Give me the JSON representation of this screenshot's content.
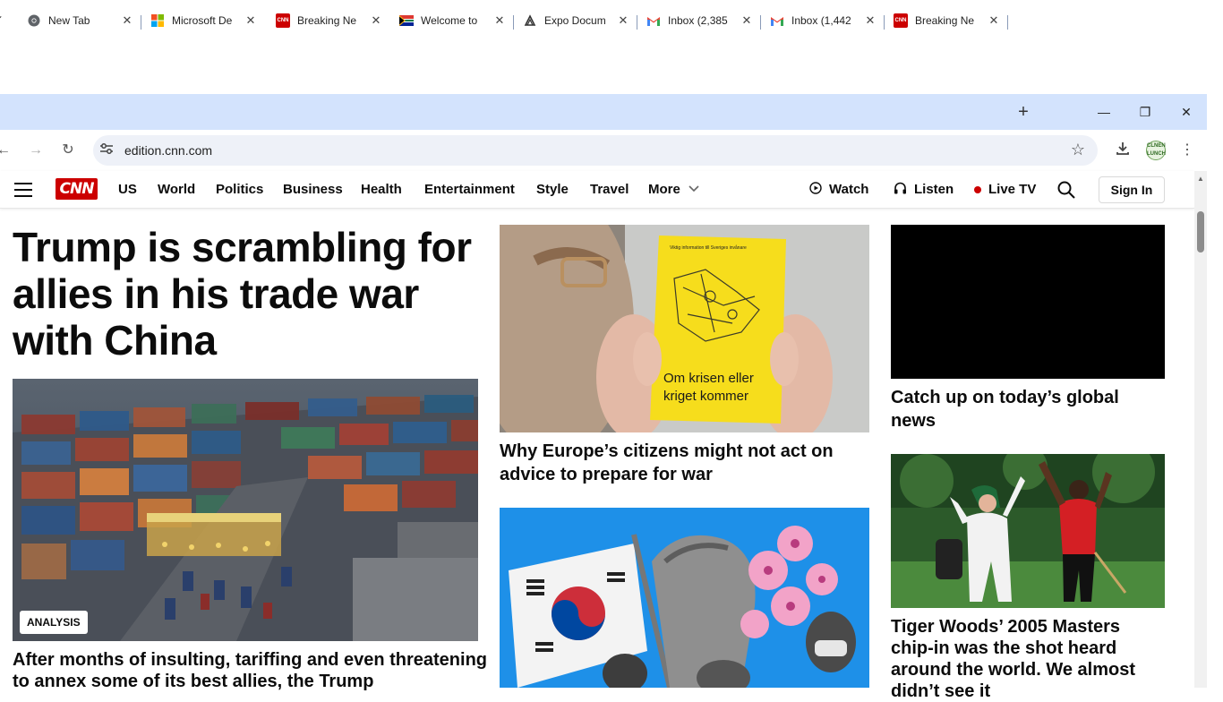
{
  "browser": {
    "tabs": [
      {
        "title": "New Tab",
        "icon": "chrome-icon",
        "active": false
      },
      {
        "title": "Microsoft De",
        "icon": "microsoft-icon",
        "active": false
      },
      {
        "title": "Breaking Ne",
        "icon": "cnn-icon",
        "active": true
      },
      {
        "title": "Welcome to",
        "icon": "south-africa-flag-icon",
        "active": false
      },
      {
        "title": "Expo Docum",
        "icon": "expo-icon",
        "active": false
      },
      {
        "title": "Inbox (2,385",
        "icon": "gmail-icon",
        "active": false
      },
      {
        "title": "Inbox (1,442",
        "icon": "gmail-icon",
        "active": false
      },
      {
        "title": "Breaking Ne",
        "icon": "cnn-icon",
        "active": false
      }
    ],
    "url": "edition.cnn.com",
    "profile_text": "CLNEN LUNCH"
  },
  "site": {
    "logo": "CNN",
    "nav": [
      "US",
      "World",
      "Politics",
      "Business",
      "Health",
      "Entertainment",
      "Style",
      "Travel"
    ],
    "more": "More",
    "watch": "Watch",
    "listen": "Listen",
    "live_tv": "Live TV",
    "sign_in": "Sign In",
    "brand_color": "#cc0000"
  },
  "content": {
    "headline": "Trump is scrambling for allies in his trade war with China",
    "analysis_badge": "ANALYSIS",
    "lead_subtext": "After months of insulting, tariffing and even threatening to annex some of its best allies, the Trump",
    "europe_title": "Why Europe’s citizens might not act on advice to prepare for war",
    "booklet_top": "Viktig information till Sveriges invånare",
    "booklet_text": "Om krisen eller kriget kommer",
    "video_title": "Catch up on today’s global news",
    "tiger_title": "Tiger Woods’ 2005 Masters chip-in was the shot heard around the world. We almost didn’t see it"
  }
}
